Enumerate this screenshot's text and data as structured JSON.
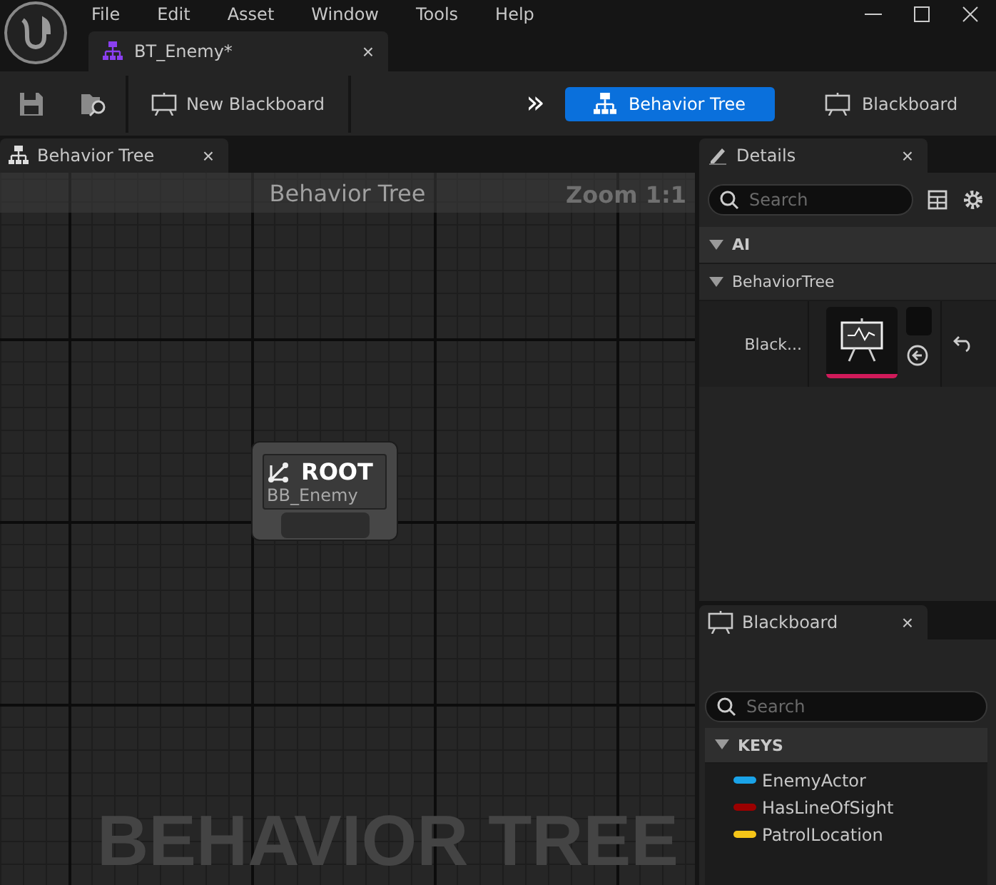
{
  "menu": [
    "File",
    "Edit",
    "Asset",
    "Window",
    "Tools",
    "Help"
  ],
  "document_tab": {
    "label": "BT_Enemy*",
    "close": "×"
  },
  "toolbar": {
    "new_blackboard": "New Blackboard",
    "overflow": "»",
    "modes": [
      {
        "label": "Behavior Tree",
        "selected": true,
        "kind": "tree"
      },
      {
        "label": "Blackboard",
        "selected": false,
        "kind": "board"
      }
    ]
  },
  "graph_panel": {
    "tab": "Behavior Tree",
    "close": "×",
    "title": "Behavior Tree",
    "zoom": "Zoom 1:1",
    "watermark": "BEHAVIOR TREE",
    "node": {
      "title": "ROOT",
      "subtitle": "BB_Enemy"
    }
  },
  "details": {
    "tab": "Details",
    "close": "×",
    "search": {
      "placeholder": "Search"
    },
    "categories": [
      {
        "label": "AI",
        "expanded": true
      },
      {
        "label": "BehaviorTree",
        "expanded": true
      }
    ],
    "property": {
      "name": "Black..."
    }
  },
  "blackboard": {
    "tab": "Blackboard",
    "close": "×",
    "search": {
      "placeholder": "Search"
    },
    "section": {
      "label": "KEYS",
      "expanded": true
    },
    "keys": [
      {
        "name": "EnemyActor",
        "color": "#1aa3e8"
      },
      {
        "name": "HasLineOfSight",
        "color": "#9b0000"
      },
      {
        "name": "PatrolLocation",
        "color": "#f5c518"
      }
    ]
  }
}
